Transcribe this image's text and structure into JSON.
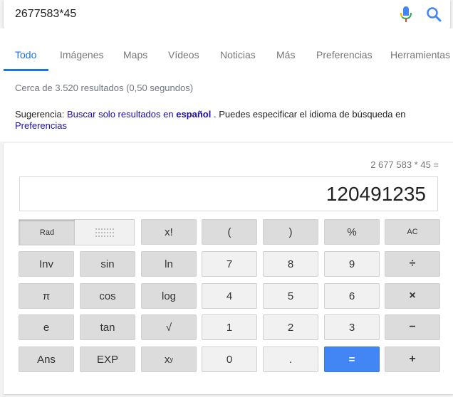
{
  "search": {
    "query": "2677583*45",
    "mic_icon": "microphone-icon",
    "search_icon": "search-icon"
  },
  "tabs": [
    {
      "label": "Todo",
      "active": true
    },
    {
      "label": "Imágenes"
    },
    {
      "label": "Maps"
    },
    {
      "label": "Vídeos"
    },
    {
      "label": "Noticias"
    },
    {
      "label": "Más"
    },
    {
      "label": "Preferencias"
    },
    {
      "label": "Herramientas"
    }
  ],
  "results": {
    "stats": "Cerca de 3.520 resultados (0,50 segundos)",
    "suggestion_prefix": "Sugerencia: ",
    "suggestion_link": "Buscar solo resultados en",
    "suggestion_bold": "español",
    "suggestion_rest": ". Puedes especificar el idioma de búsqueda en",
    "suggestion_link2": "Preferencias"
  },
  "calculator": {
    "formula": "2 677 583 * 45 =",
    "display": "120491235",
    "rad_label": "Rad",
    "buttons": {
      "fact": "x!",
      "lparen": "(",
      "rparen": ")",
      "percent": "%",
      "ac": "AC",
      "inv": "Inv",
      "sin": "sin",
      "ln": "ln",
      "seven": "7",
      "eight": "8",
      "nine": "9",
      "divide": "÷",
      "pi": "π",
      "cos": "cos",
      "log": "log",
      "four": "4",
      "five": "5",
      "six": "6",
      "multiply": "×",
      "e": "e",
      "tan": "tan",
      "sqrt": "√",
      "one": "1",
      "two": "2",
      "three": "3",
      "minus": "−",
      "ans": "Ans",
      "exp": "EXP",
      "pow_base": "x",
      "pow_exp": "y",
      "zero": "0",
      "dot": ".",
      "equals": "=",
      "plus": "+"
    }
  },
  "colors": {
    "accent": "#1a73e8",
    "equals_button": "#4285f4",
    "link": "#1a0dab"
  }
}
